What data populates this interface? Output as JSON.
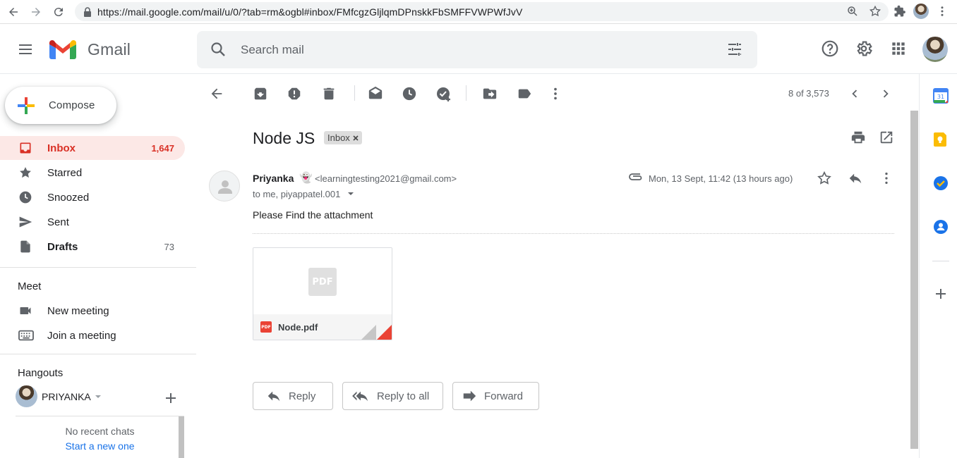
{
  "browser": {
    "url": "https://mail.google.com/mail/u/0/?tab=rm&ogbl#inbox/FMfcgzGljlqmDPnskkFbSMFFVWPWfJvV"
  },
  "header": {
    "app_name": "Gmail",
    "search_placeholder": "Search mail"
  },
  "sidebar": {
    "compose_label": "Compose",
    "items": [
      {
        "label": "Inbox",
        "count": "1,647"
      },
      {
        "label": "Starred",
        "count": ""
      },
      {
        "label": "Snoozed",
        "count": ""
      },
      {
        "label": "Sent",
        "count": ""
      },
      {
        "label": "Drafts",
        "count": "73"
      }
    ],
    "meet": {
      "title": "Meet",
      "items": [
        {
          "label": "New meeting"
        },
        {
          "label": "Join a meeting"
        }
      ]
    },
    "hangouts": {
      "title": "Hangouts",
      "user": "PRIYANKA",
      "no_chats": "No recent chats",
      "start_link": "Start a new one"
    }
  },
  "toolbar": {
    "pager": "8 of 3,573"
  },
  "email": {
    "subject": "Node JS",
    "label": "Inbox",
    "sender_name": "Priyanka",
    "sender_emoji": "👻",
    "sender_email": "<learningtesting2021@gmail.com>",
    "to_line": "to me, piyappatel.001",
    "date": "Mon, 13 Sept, 11:42 (13 hours ago)",
    "body": "Please Find the attachment",
    "attachment": {
      "preview_text": "PDF",
      "badge_text": "PDF",
      "filename": "Node.pdf"
    }
  },
  "actions": {
    "reply": "Reply",
    "reply_all": "Reply to all",
    "forward": "Forward"
  },
  "colors": {
    "accent_red": "#d93025",
    "active_bg": "#fce8e6",
    "link_blue": "#1a73e8"
  }
}
